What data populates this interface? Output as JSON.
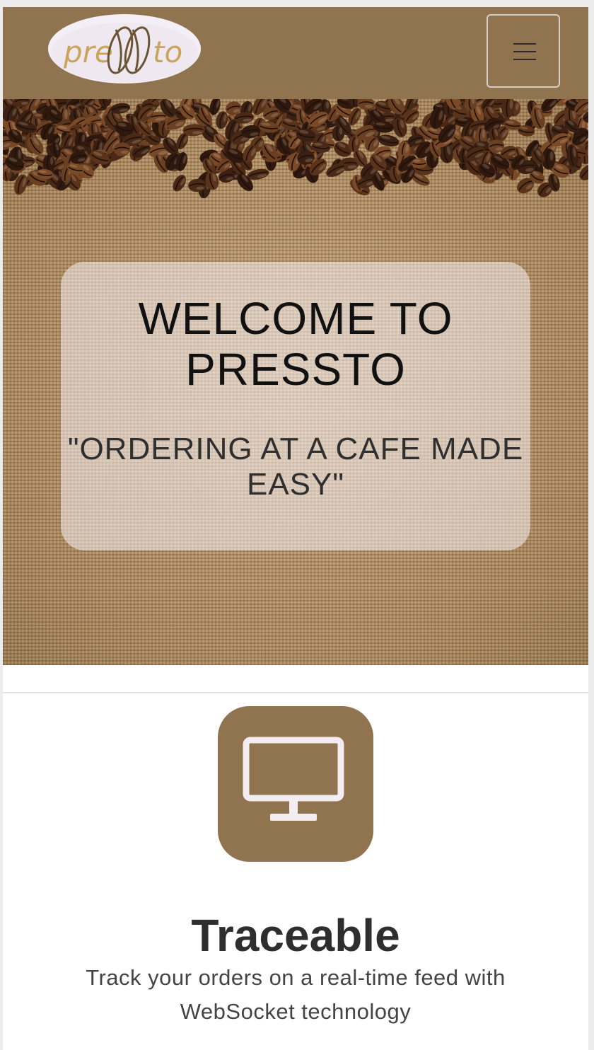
{
  "navbar": {
    "logo_text": "presto",
    "menu_button_icon": "hamburger-menu-icon",
    "background_color": "#8f744f"
  },
  "hero": {
    "background": "coffee beans on burlap",
    "title": "WELCOME TO PRESSTO",
    "subtitle": "\"ORDERING AT A CAFE MADE EASY\""
  },
  "features": [
    {
      "icon": "desktop-monitor-icon",
      "title": "Traceable",
      "description": "Track your orders on a real-time feed with WebSocket technology"
    }
  ],
  "colors": {
    "brand_brown": "#8f744f",
    "icon_stroke": "#f3ecf1",
    "logo_gold": "#c9a45a"
  }
}
